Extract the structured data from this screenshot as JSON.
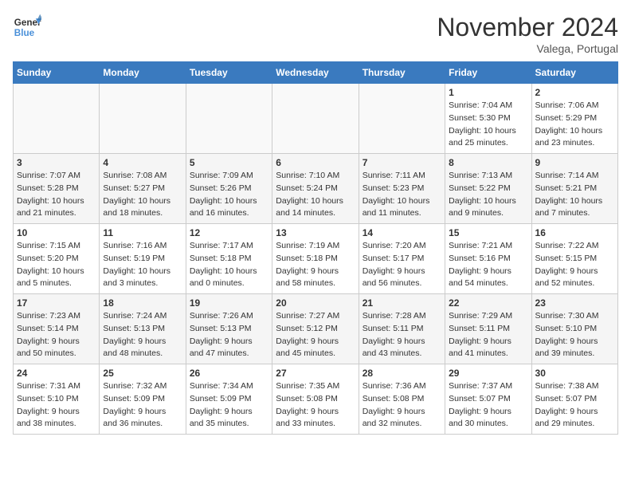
{
  "header": {
    "logo_line1": "General",
    "logo_line2": "Blue",
    "month": "November 2024",
    "location": "Valega, Portugal"
  },
  "weekdays": [
    "Sunday",
    "Monday",
    "Tuesday",
    "Wednesday",
    "Thursday",
    "Friday",
    "Saturday"
  ],
  "weeks": [
    [
      {
        "day": "",
        "info": ""
      },
      {
        "day": "",
        "info": ""
      },
      {
        "day": "",
        "info": ""
      },
      {
        "day": "",
        "info": ""
      },
      {
        "day": "",
        "info": ""
      },
      {
        "day": "1",
        "info": "Sunrise: 7:04 AM\nSunset: 5:30 PM\nDaylight: 10 hours\nand 25 minutes."
      },
      {
        "day": "2",
        "info": "Sunrise: 7:06 AM\nSunset: 5:29 PM\nDaylight: 10 hours\nand 23 minutes."
      }
    ],
    [
      {
        "day": "3",
        "info": "Sunrise: 7:07 AM\nSunset: 5:28 PM\nDaylight: 10 hours\nand 21 minutes."
      },
      {
        "day": "4",
        "info": "Sunrise: 7:08 AM\nSunset: 5:27 PM\nDaylight: 10 hours\nand 18 minutes."
      },
      {
        "day": "5",
        "info": "Sunrise: 7:09 AM\nSunset: 5:26 PM\nDaylight: 10 hours\nand 16 minutes."
      },
      {
        "day": "6",
        "info": "Sunrise: 7:10 AM\nSunset: 5:24 PM\nDaylight: 10 hours\nand 14 minutes."
      },
      {
        "day": "7",
        "info": "Sunrise: 7:11 AM\nSunset: 5:23 PM\nDaylight: 10 hours\nand 11 minutes."
      },
      {
        "day": "8",
        "info": "Sunrise: 7:13 AM\nSunset: 5:22 PM\nDaylight: 10 hours\nand 9 minutes."
      },
      {
        "day": "9",
        "info": "Sunrise: 7:14 AM\nSunset: 5:21 PM\nDaylight: 10 hours\nand 7 minutes."
      }
    ],
    [
      {
        "day": "10",
        "info": "Sunrise: 7:15 AM\nSunset: 5:20 PM\nDaylight: 10 hours\nand 5 minutes."
      },
      {
        "day": "11",
        "info": "Sunrise: 7:16 AM\nSunset: 5:19 PM\nDaylight: 10 hours\nand 3 minutes."
      },
      {
        "day": "12",
        "info": "Sunrise: 7:17 AM\nSunset: 5:18 PM\nDaylight: 10 hours\nand 0 minutes."
      },
      {
        "day": "13",
        "info": "Sunrise: 7:19 AM\nSunset: 5:18 PM\nDaylight: 9 hours\nand 58 minutes."
      },
      {
        "day": "14",
        "info": "Sunrise: 7:20 AM\nSunset: 5:17 PM\nDaylight: 9 hours\nand 56 minutes."
      },
      {
        "day": "15",
        "info": "Sunrise: 7:21 AM\nSunset: 5:16 PM\nDaylight: 9 hours\nand 54 minutes."
      },
      {
        "day": "16",
        "info": "Sunrise: 7:22 AM\nSunset: 5:15 PM\nDaylight: 9 hours\nand 52 minutes."
      }
    ],
    [
      {
        "day": "17",
        "info": "Sunrise: 7:23 AM\nSunset: 5:14 PM\nDaylight: 9 hours\nand 50 minutes."
      },
      {
        "day": "18",
        "info": "Sunrise: 7:24 AM\nSunset: 5:13 PM\nDaylight: 9 hours\nand 48 minutes."
      },
      {
        "day": "19",
        "info": "Sunrise: 7:26 AM\nSunset: 5:13 PM\nDaylight: 9 hours\nand 47 minutes."
      },
      {
        "day": "20",
        "info": "Sunrise: 7:27 AM\nSunset: 5:12 PM\nDaylight: 9 hours\nand 45 minutes."
      },
      {
        "day": "21",
        "info": "Sunrise: 7:28 AM\nSunset: 5:11 PM\nDaylight: 9 hours\nand 43 minutes."
      },
      {
        "day": "22",
        "info": "Sunrise: 7:29 AM\nSunset: 5:11 PM\nDaylight: 9 hours\nand 41 minutes."
      },
      {
        "day": "23",
        "info": "Sunrise: 7:30 AM\nSunset: 5:10 PM\nDaylight: 9 hours\nand 39 minutes."
      }
    ],
    [
      {
        "day": "24",
        "info": "Sunrise: 7:31 AM\nSunset: 5:10 PM\nDaylight: 9 hours\nand 38 minutes."
      },
      {
        "day": "25",
        "info": "Sunrise: 7:32 AM\nSunset: 5:09 PM\nDaylight: 9 hours\nand 36 minutes."
      },
      {
        "day": "26",
        "info": "Sunrise: 7:34 AM\nSunset: 5:09 PM\nDaylight: 9 hours\nand 35 minutes."
      },
      {
        "day": "27",
        "info": "Sunrise: 7:35 AM\nSunset: 5:08 PM\nDaylight: 9 hours\nand 33 minutes."
      },
      {
        "day": "28",
        "info": "Sunrise: 7:36 AM\nSunset: 5:08 PM\nDaylight: 9 hours\nand 32 minutes."
      },
      {
        "day": "29",
        "info": "Sunrise: 7:37 AM\nSunset: 5:07 PM\nDaylight: 9 hours\nand 30 minutes."
      },
      {
        "day": "30",
        "info": "Sunrise: 7:38 AM\nSunset: 5:07 PM\nDaylight: 9 hours\nand 29 minutes."
      }
    ]
  ]
}
